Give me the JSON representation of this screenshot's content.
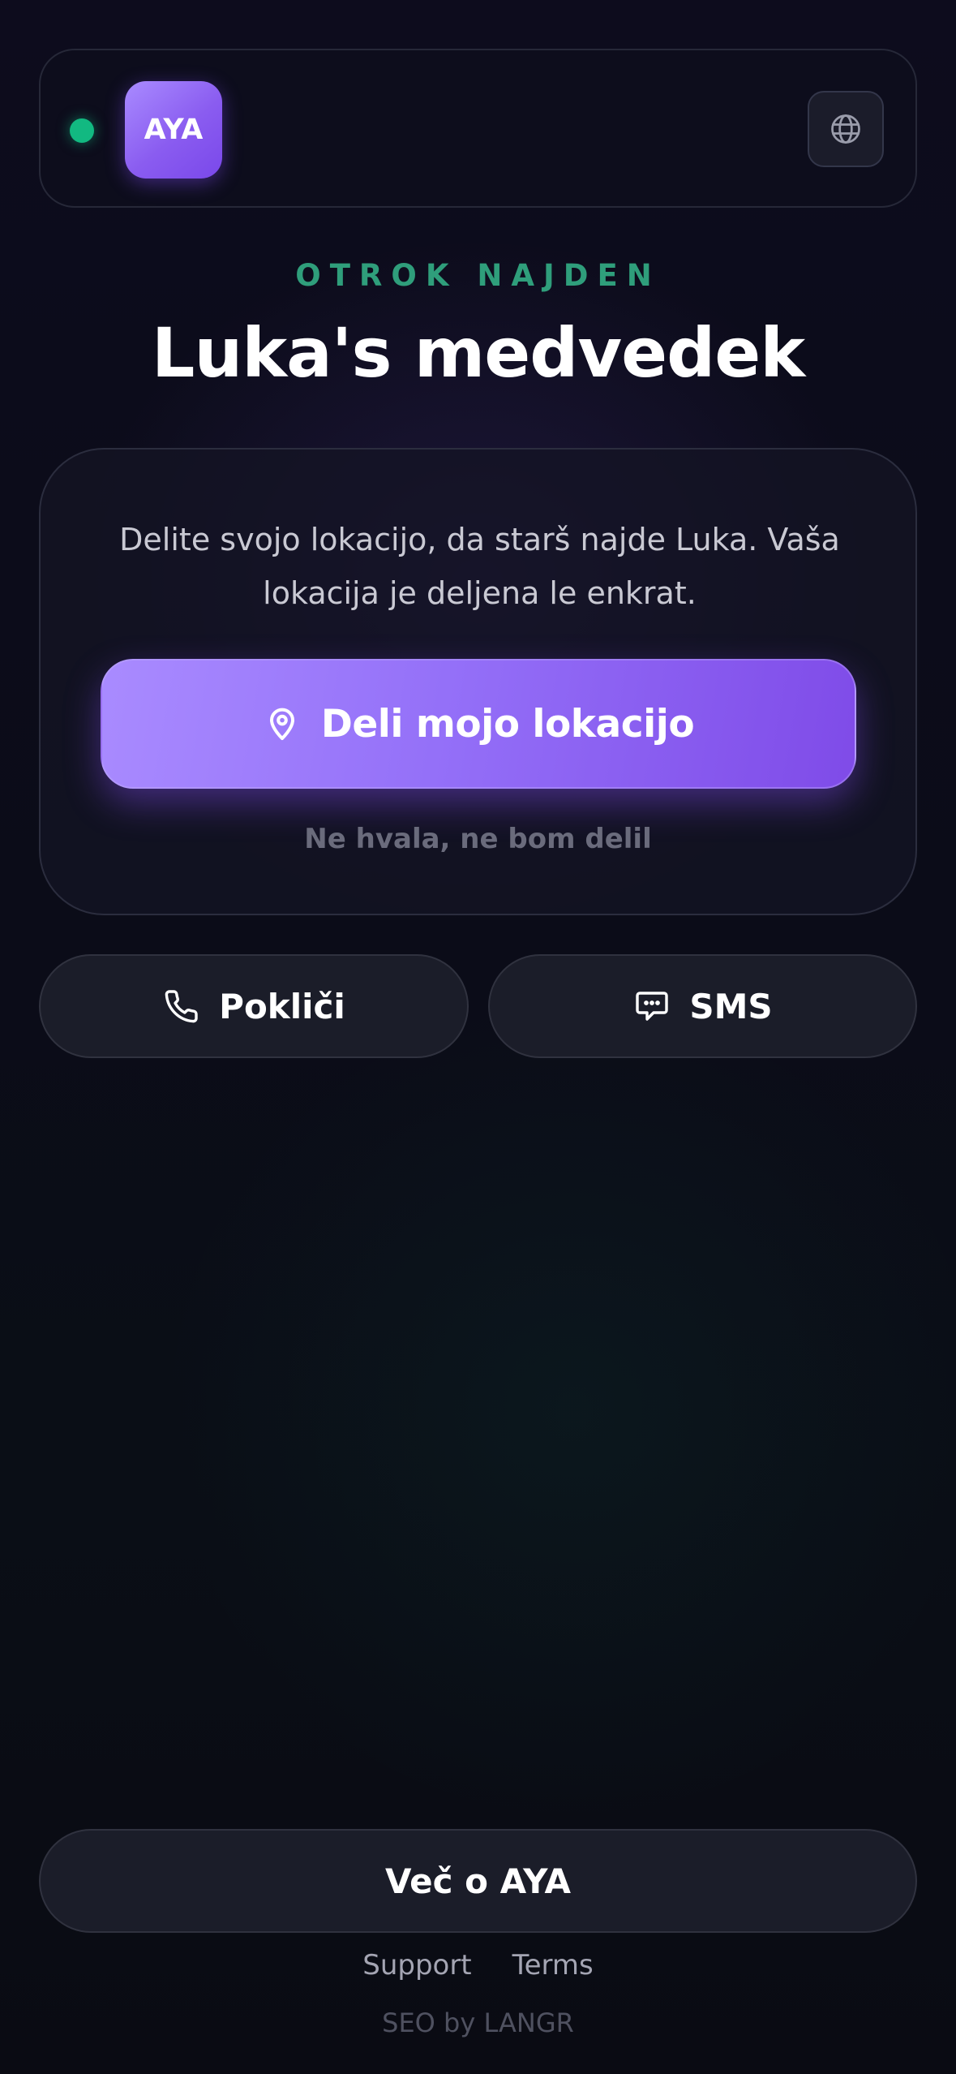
{
  "header": {
    "status": "online",
    "logo_text": "AYA",
    "language_icon": "globe-icon"
  },
  "hero": {
    "eyebrow": "OTROK NAJDEN",
    "title": "Luka's medvedek"
  },
  "share_card": {
    "description": "Delite svojo lokacijo, da starš najde Luka. Vaša lokacija je deljena le enkrat.",
    "share_button": {
      "icon": "map-pin-icon",
      "label": "Deli mojo lokacijo"
    },
    "decline_label": "Ne hvala, ne bom delil"
  },
  "actions": {
    "call": {
      "icon": "phone-icon",
      "label": "Pokliči"
    },
    "sms": {
      "icon": "chat-bubble-icon",
      "label": "SMS"
    }
  },
  "footer": {
    "more_label": "Več o AYA",
    "links": [
      "Support",
      "Terms"
    ],
    "credit": "SEO by LANGR"
  },
  "colors": {
    "accent_purple": "#8b5cf6",
    "status_green": "#12b981",
    "eyebrow_green": "#2f9e7b",
    "background": "#0c0c1a"
  }
}
